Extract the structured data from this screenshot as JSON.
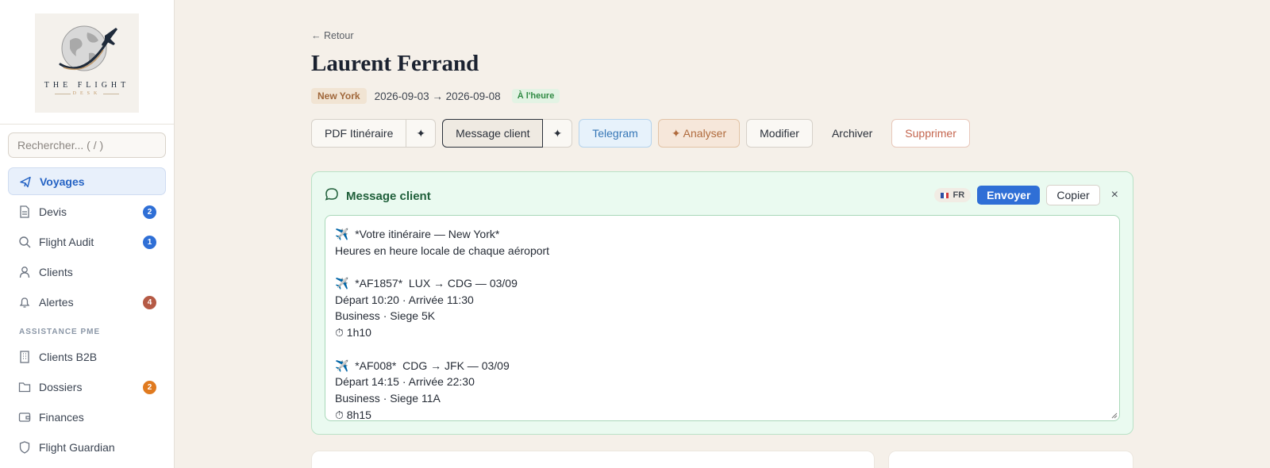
{
  "brand": {
    "line1": "THE FLIGHT",
    "line2": "DESK"
  },
  "search": {
    "placeholder": "Rechercher...  ( / )"
  },
  "nav": {
    "items": [
      {
        "label": "Voyages",
        "icon": "plane-icon",
        "active": true
      },
      {
        "label": "Devis",
        "icon": "document-icon",
        "badge": "2"
      },
      {
        "label": "Flight Audit",
        "icon": "search-icon",
        "badge": "1"
      },
      {
        "label": "Clients",
        "icon": "user-icon"
      },
      {
        "label": "Alertes",
        "icon": "bell-icon",
        "badge": "4"
      }
    ],
    "section_label": "ASSISTANCE PME",
    "section_items": [
      {
        "label": "Clients B2B",
        "icon": "building-icon"
      },
      {
        "label": "Dossiers",
        "icon": "folder-icon",
        "badge": "2"
      },
      {
        "label": "Finances",
        "icon": "wallet-icon"
      },
      {
        "label": "Flight Guardian",
        "icon": "shield-icon"
      }
    ]
  },
  "header": {
    "back": "← Retour",
    "title": "Laurent Ferrand",
    "city": "New York",
    "dates": "2026-09-03 → 2026-09-08",
    "status": "À l'heure"
  },
  "toolbar": {
    "pdf": "PDF Itinéraire",
    "sparkle": "✦",
    "message": "Message client",
    "telegram": "Telegram",
    "analyze": "✦ Analyser",
    "edit": "Modifier",
    "archive": "Archiver",
    "delete": "Supprimer"
  },
  "panel": {
    "title": "Message client",
    "lang": "FR",
    "send": "Envoyer",
    "copy": "Copier",
    "close": "×",
    "lines": [
      "✈️  *Votre itinéraire — New York*",
      "Heures en heure locale de chaque aéroport",
      "",
      "✈️  *AF1857*  LUX → CDG — 03/09",
      "Départ 10:20 · Arrivée 11:30",
      "Business · Siege 5K",
      "⏱ 1h10",
      "",
      "✈️  *AF008*  CDG → JFK — 03/09",
      "Départ 14:15 · Arrivée 22:30",
      "Business · Siege 11A",
      "⏱ 8h15"
    ]
  },
  "colors": {
    "accent": "#2f6fd6",
    "panel_bg": "#eafaf0",
    "status_green": "#2f8a43",
    "city_tag": "#a0673a"
  }
}
